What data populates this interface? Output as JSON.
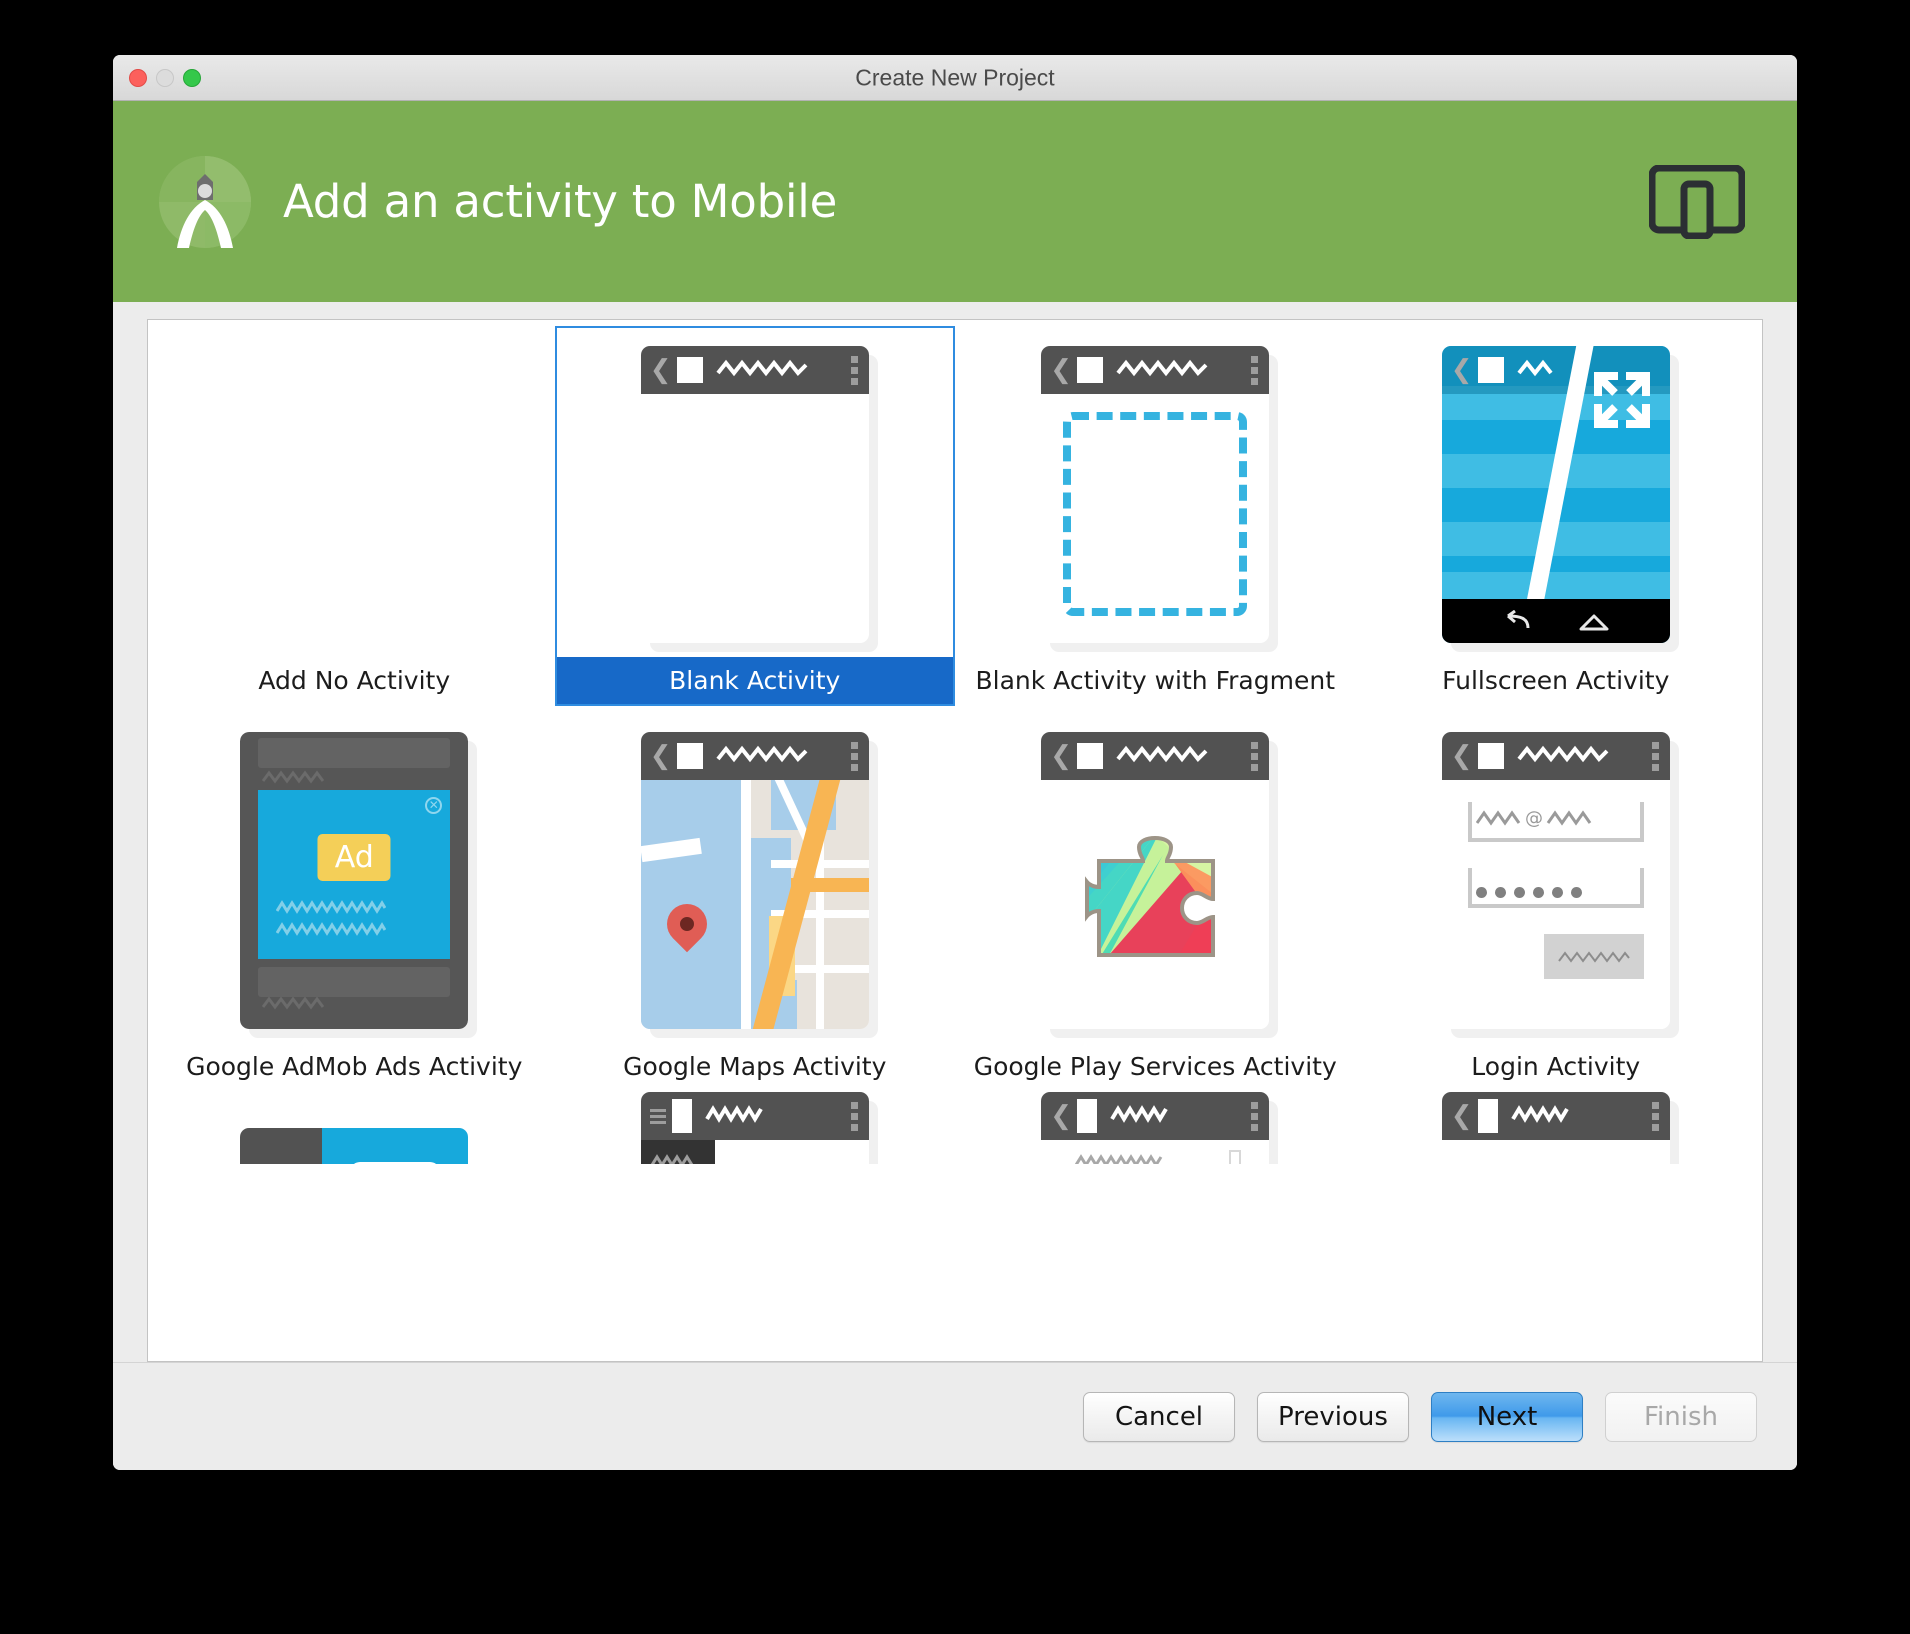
{
  "window": {
    "title": "Create New Project",
    "traffic_lights": [
      "close",
      "minimize",
      "zoom"
    ]
  },
  "header": {
    "title": "Add an activity to Mobile",
    "logo_name": "android-studio-logo",
    "device_icon_name": "mobile-and-tablet-icon",
    "background_color": "#7cae53"
  },
  "grid": {
    "selected_index": 1,
    "selection_color": "#1769c8",
    "items": [
      {
        "label": "Add No Activity",
        "thumb": "none"
      },
      {
        "label": "Blank Activity",
        "thumb": "blank"
      },
      {
        "label": "Blank Activity with Fragment",
        "thumb": "fragment"
      },
      {
        "label": "Fullscreen Activity",
        "thumb": "fullscreen"
      },
      {
        "label": "Google AdMob Ads Activity",
        "thumb": "admob"
      },
      {
        "label": "Google Maps Activity",
        "thumb": "maps"
      },
      {
        "label": "Google Play Services Activity",
        "thumb": "play-services"
      },
      {
        "label": "Login Activity",
        "thumb": "login"
      }
    ],
    "partial_row": [
      {
        "thumb": "master-detail"
      },
      {
        "thumb": "navigation-drawer"
      },
      {
        "thumb": "settings"
      },
      {
        "thumb": "tabbed"
      }
    ],
    "ad_badge_text": "Ad"
  },
  "footer": {
    "buttons": [
      {
        "label": "Cancel",
        "state": "normal"
      },
      {
        "label": "Previous",
        "state": "normal"
      },
      {
        "label": "Next",
        "state": "primary"
      },
      {
        "label": "Finish",
        "state": "disabled"
      }
    ]
  }
}
